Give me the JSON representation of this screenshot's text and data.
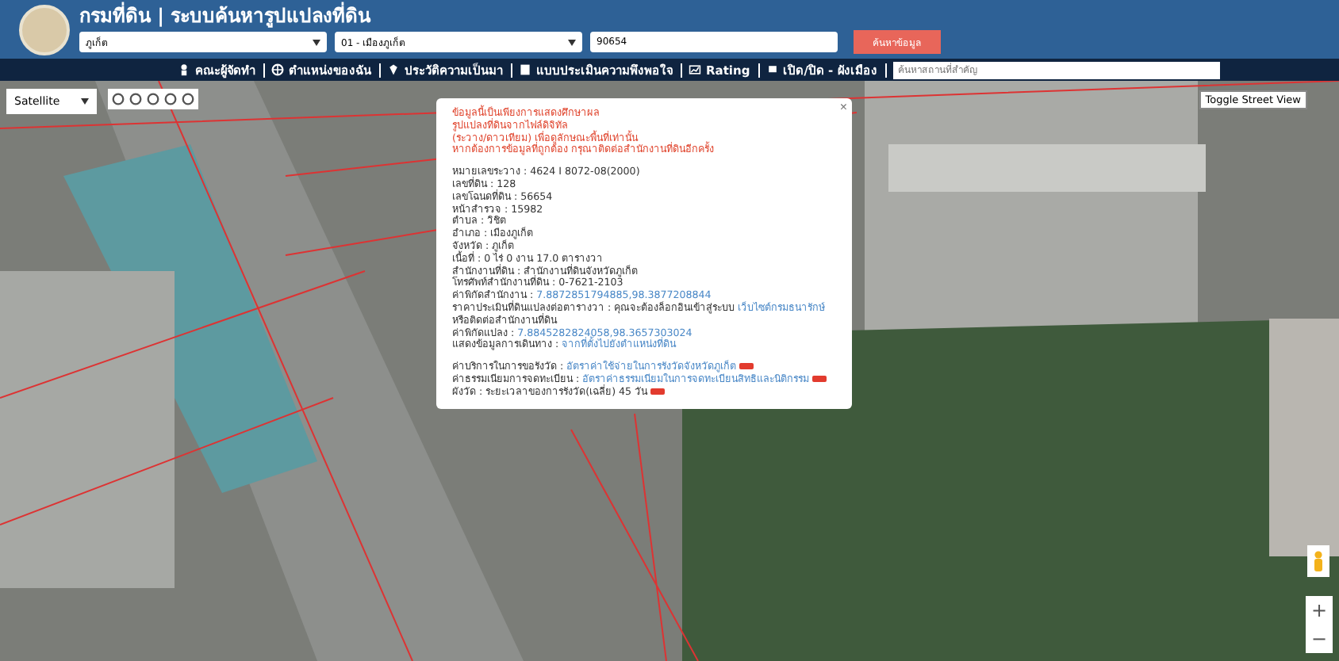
{
  "header": {
    "title": "กรมที่ดิน | ระบบค้นหารูปแปลงที่ดิน",
    "province": "ภูเก็ต",
    "district": "01 - เมืองภูเก็ต",
    "parcel_number": "90654",
    "search_button": "ค้นหาข้อมูล"
  },
  "nav": [
    {
      "kind": "person",
      "label": "คณะผู้จัดทำ"
    },
    {
      "kind": "globe",
      "label": "ตำแหน่งของฉัน"
    },
    {
      "kind": "pin",
      "label": "ประวัติความเป็นมา"
    },
    {
      "kind": "form",
      "label": "แบบประเมินความพึงพอใจ"
    },
    {
      "kind": "chart",
      "label": "Rating"
    },
    {
      "kind": "flag",
      "label": "เปิด/ปิด - ผังเมือง"
    }
  ],
  "place_search": {
    "placeholder": "ค้นหาสถานที่สำคัญ"
  },
  "map": {
    "map_type": "Satellite",
    "street_view_button": "Toggle Street View",
    "zoom_in": "+",
    "zoom_out": "−"
  },
  "popup": {
    "notice": [
      "ข้อมูลนี้เป็นเพียงการแสดงศึกษาผล",
      "รูปแปลงที่ดินจากไฟล์ดิจิทัล",
      "(ระวาง/ดาวเทียม) เพื่อดูลักษณะพื้นที่เท่านั้น",
      "หากต้องการข้อมูลที่ถูกต้อง กรุณาติดต่อสำนักงานที่ดินอีกครั้ง"
    ],
    "close": "×",
    "info": [
      {
        "label": "หมายเลขระวาง :",
        "value": "4624 I 8072-08(2000)",
        "kind": "plain"
      },
      {
        "label": "เลขที่ดิน :",
        "value": "128",
        "kind": "plain"
      },
      {
        "label": "เลขโฉนดที่ดิน :",
        "value": "56654",
        "kind": "plain"
      },
      {
        "label": "หน้าสำรวจ :",
        "value": "15982",
        "kind": "plain"
      },
      {
        "label": "ตำบล :",
        "value": "วิชิต",
        "kind": "plain"
      },
      {
        "label": "อำเภอ :",
        "value": "เมืองภูเก็ต",
        "kind": "plain"
      },
      {
        "label": "จังหวัด :",
        "value": "ภูเก็ต",
        "kind": "plain"
      },
      {
        "label": "เนื้อที่ :",
        "value": "0 ไร่ 0 งาน 17.0 ตารางวา",
        "kind": "plain"
      },
      {
        "label": "สำนักงานที่ดิน :",
        "value": "สำนักงานที่ดินจังหวัดภูเก็ต",
        "kind": "plain"
      },
      {
        "label": "โทรศัพท์สำนักงานที่ดิน :",
        "value": "0-7621-2103",
        "kind": "plain"
      },
      {
        "label": "ค่าพิกัดสำนักงาน :",
        "value": "7.8872851794885,98.3877208844",
        "kind": "link"
      },
      {
        "label": "ราคาประเมินที่ดินแปลงต่อตารางวา :",
        "value": "คุณจะต้องล็อกอินเข้าสู่ระบบ",
        "link": "เว็บไซต์กรมธนารักษ์",
        "extra": "หรือติดต่อสำนักงานที่ดิน",
        "kind": "mixed"
      },
      {
        "label": "ค่าพิกัดแปลง :",
        "value": "7.8845282824058,98.3657303024",
        "kind": "link"
      },
      {
        "label": "แสดงข้อมูลการเดินทาง :",
        "value": "จากที่ตั้งไปยังตำแหน่งที่ดิน",
        "kind": "link"
      }
    ],
    "services": [
      {
        "label": "ค่าบริการในการขอรังวัด :",
        "value": "อัตราค่าใช้จ่ายในการรังวัดจังหวัดภูเก็ต",
        "kind": "link",
        "new": true
      },
      {
        "label": "ค่าธรรมเนียมการจดทะเบียน :",
        "value": "อัตราค่าธรรมเนียมในการจดทะเบียนสิทธิและนิติกรรม",
        "kind": "link",
        "new": true
      },
      {
        "label": "ผังวัด :",
        "value": "ระยะเวลาของการรังวัด(เฉลี่ย) 45 วัน",
        "kind": "plain",
        "new": true
      }
    ]
  }
}
